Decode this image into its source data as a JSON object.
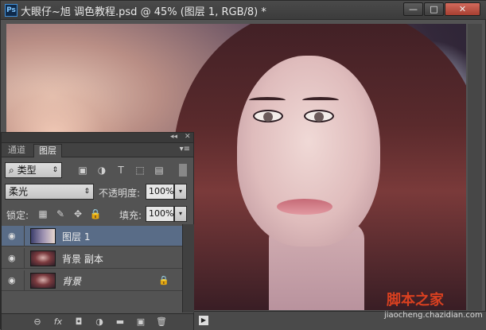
{
  "window": {
    "app_icon": "Ps",
    "title": "大眼仔~旭 调色教程.psd @ 45% (图层 1, RGB/8) *",
    "btn_min": "—",
    "btn_max": "□",
    "btn_close": "✕"
  },
  "panel": {
    "collapse": "◂◂",
    "close": "✕",
    "tabs": [
      {
        "label": "通道"
      },
      {
        "label": "图层"
      }
    ],
    "menu": "▾≡",
    "filter": {
      "icon": "⌕",
      "label": "类型",
      "arrow": "⇕"
    },
    "blend_mode": "柔光",
    "blend_arrow": "⇕",
    "opacity_label": "不透明度:",
    "opacity_value": "100%",
    "lock_label": "锁定:",
    "fill_label": "填充:",
    "fill_value": "100%",
    "num_arrow": "▾",
    "layers": [
      {
        "name": "图层 1",
        "eye": "◉"
      },
      {
        "name": "背景 副本",
        "eye": "◉"
      },
      {
        "name": "背景",
        "eye": "◉",
        "lock": "🔒"
      }
    ],
    "bottom_icons": {
      "link": "⊖",
      "fx": "fx",
      "mask": "◘",
      "adjust": "◑",
      "group": "▬",
      "new": "▣",
      "delete": "🗑"
    }
  },
  "status": {
    "play": "▶"
  },
  "watermark": {
    "line1": "脚本之家",
    "line2": "jiaocheng.chazidian.com"
  }
}
